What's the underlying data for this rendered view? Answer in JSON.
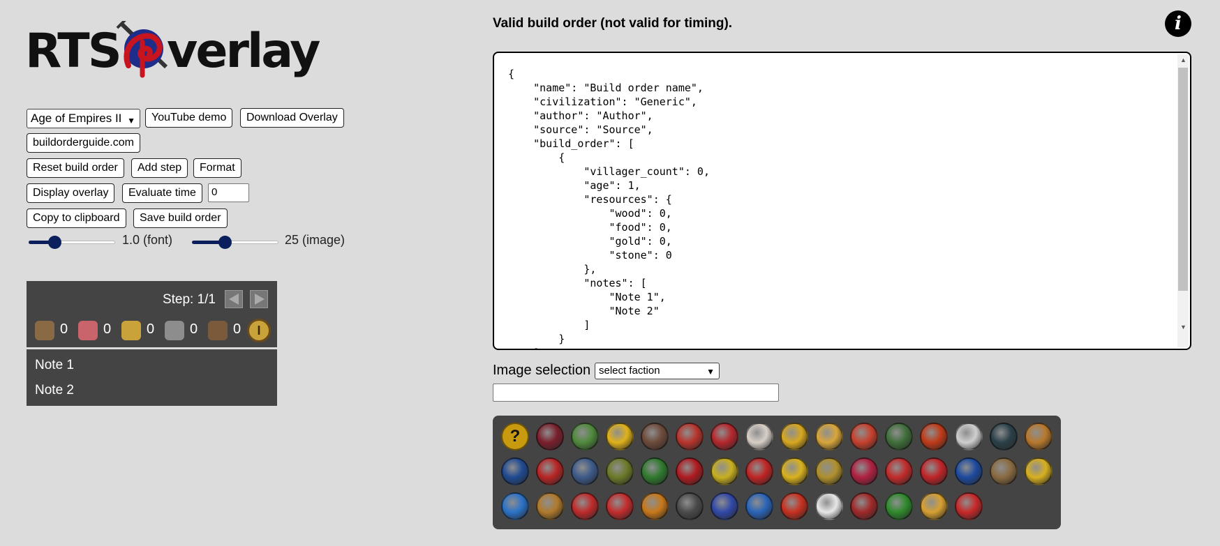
{
  "logo": {
    "word_left": "RTS",
    "word_right": "verlay"
  },
  "controls": {
    "game_select": "Age of Empires II",
    "youtube_button": "YouTube demo",
    "download_button": "Download Overlay",
    "guide_button": "buildorderguide.com",
    "reset_button": "Reset build order",
    "add_step_button": "Add step",
    "format_button": "Format",
    "display_button": "Display overlay",
    "evaluate_button": "Evaluate time",
    "evaluate_value": "0",
    "copy_button": "Copy to clipboard",
    "save_button": "Save build order",
    "font_slider": {
      "label": "1.0 (font)",
      "level": 0.3
    },
    "image_slider": {
      "label": "25 (image)",
      "level": 0.38
    }
  },
  "overlay": {
    "step_text": "Step: 1/1",
    "resources": [
      {
        "icon": "wood-icon",
        "value": "0",
        "color": "#8a6a44"
      },
      {
        "icon": "food-icon",
        "value": "0",
        "color": "#c8646a"
      },
      {
        "icon": "gold-icon",
        "value": "0",
        "color": "#c9a23a"
      },
      {
        "icon": "stone-icon",
        "value": "0",
        "color": "#8d8d8d"
      },
      {
        "icon": "villager-icon",
        "value": "0",
        "color": "#7a5a3a"
      }
    ],
    "notes": [
      "Note 1",
      "Note 2"
    ]
  },
  "validation_message": "Valid build order (not valid for timing).",
  "editor_text": "{\n    \"name\": \"Build order name\",\n    \"civilization\": \"Generic\",\n    \"author\": \"Author\",\n    \"source\": \"Source\",\n    \"build_order\": [\n        {\n            \"villager_count\": 0,\n            \"age\": 1,\n            \"resources\": {\n                \"wood\": 0,\n                \"food\": 0,\n                \"gold\": 0,\n                \"stone\": 0\n            },\n            \"notes\": [\n                \"Note 1\",\n                \"Note 2\"\n            ]\n        }\n    ]\n}",
  "image_selection": {
    "label": "Image selection",
    "select": "select faction",
    "search_value": ""
  },
  "factions": [
    [
      "#c79a10",
      "#7a1f2c",
      "#4f8a3c",
      "#e0b21a",
      "#6d4a3a",
      "#b8342c",
      "#b5262c",
      "#d8d0c8",
      "#d8a81e",
      "#d9a63a",
      "#c8402c",
      "#3f6e3a",
      "#c03a18",
      "#cfcfcf",
      "#2a4048",
      "#b8782c"
    ],
    [
      "#1f4a92",
      "#b82424",
      "#3d5a8a",
      "#6b7a28",
      "#2f7a2e",
      "#b01a20",
      "#c8b020",
      "#c02424",
      "#d9b21e",
      "#b0902c",
      "#b02040",
      "#c22a2a",
      "#c02428",
      "#1c4aa0",
      "#8a6a40",
      "#d8b020"
    ],
    [
      "#2a72c8",
      "#b07a2c",
      "#c02a2a",
      "#c42c2c",
      "#c8781a",
      "#4a4a4a",
      "#3048a8",
      "#2a64b8",
      "#c83020",
      "#e8e8e8",
      "#a02828",
      "#2f8a2c",
      "#d8a030",
      "#c82828"
    ]
  ]
}
